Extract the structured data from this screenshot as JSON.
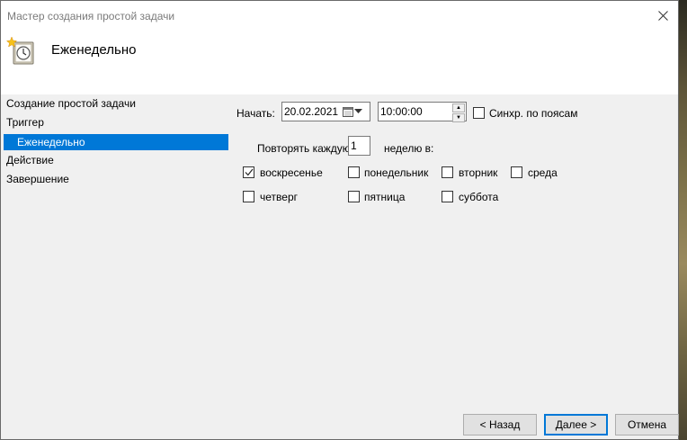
{
  "window": {
    "title": "Мастер создания простой задачи"
  },
  "header": {
    "title": "Еженедельно"
  },
  "sidebar": {
    "items": [
      {
        "label": "Создание простой задачи"
      },
      {
        "label": "Триггер"
      },
      {
        "label": "Еженедельно"
      },
      {
        "label": "Действие"
      },
      {
        "label": "Завершение"
      }
    ]
  },
  "schedule": {
    "start_label": "Начать:",
    "start_date": "20.02.2021",
    "start_time": "10:00:00",
    "sync_label": "Синхр. по поясам",
    "sync_checked": false,
    "repeat_label": "Повторять каждую",
    "repeat_value": "1",
    "weeks_label": "неделю в:"
  },
  "days": [
    {
      "label": "воскресенье",
      "checked": true
    },
    {
      "label": "понедельник",
      "checked": false
    },
    {
      "label": "вторник",
      "checked": false
    },
    {
      "label": "среда",
      "checked": false
    },
    {
      "label": "четверг",
      "checked": false
    },
    {
      "label": "пятница",
      "checked": false
    },
    {
      "label": "суббота",
      "checked": false
    }
  ],
  "footer": {
    "back_label": "< Назад",
    "next_label": "Далее >",
    "cancel_label": "Отмена"
  },
  "colors": {
    "accent": "#0078d7"
  }
}
